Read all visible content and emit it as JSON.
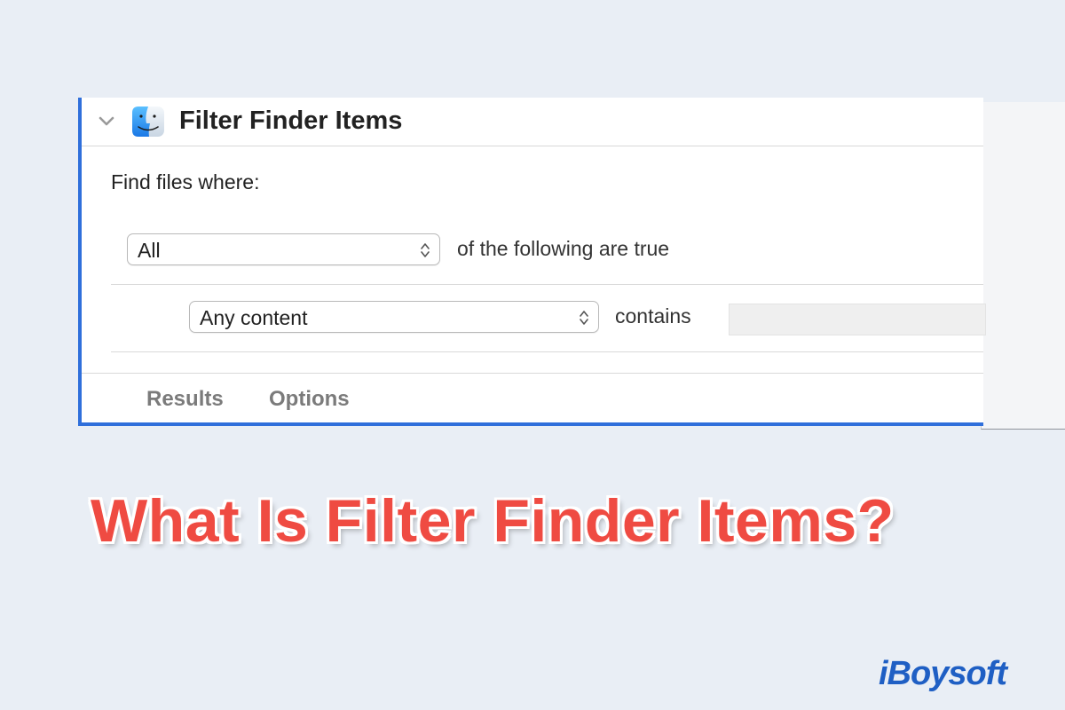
{
  "action": {
    "title": "Filter Finder Items",
    "find_label": "Find files where:",
    "match_select": {
      "value": "All"
    },
    "match_suffix": "of the following are true",
    "criteria": {
      "field_select": {
        "value": "Any content"
      },
      "operator": "contains",
      "value": ""
    },
    "tabs": [
      {
        "label": "Results"
      },
      {
        "label": "Options"
      }
    ]
  },
  "headline": "What Is Filter Finder Items?",
  "brand": {
    "logo_text": "iBoysoft"
  },
  "colors": {
    "accent_border": "#2f6fdb",
    "headline": "#ef4b42",
    "logo": "#1f5fc4",
    "background": "#e9eef5"
  },
  "icons": [
    "chevron-down-icon",
    "finder-icon",
    "updown-arrows-icon"
  ]
}
